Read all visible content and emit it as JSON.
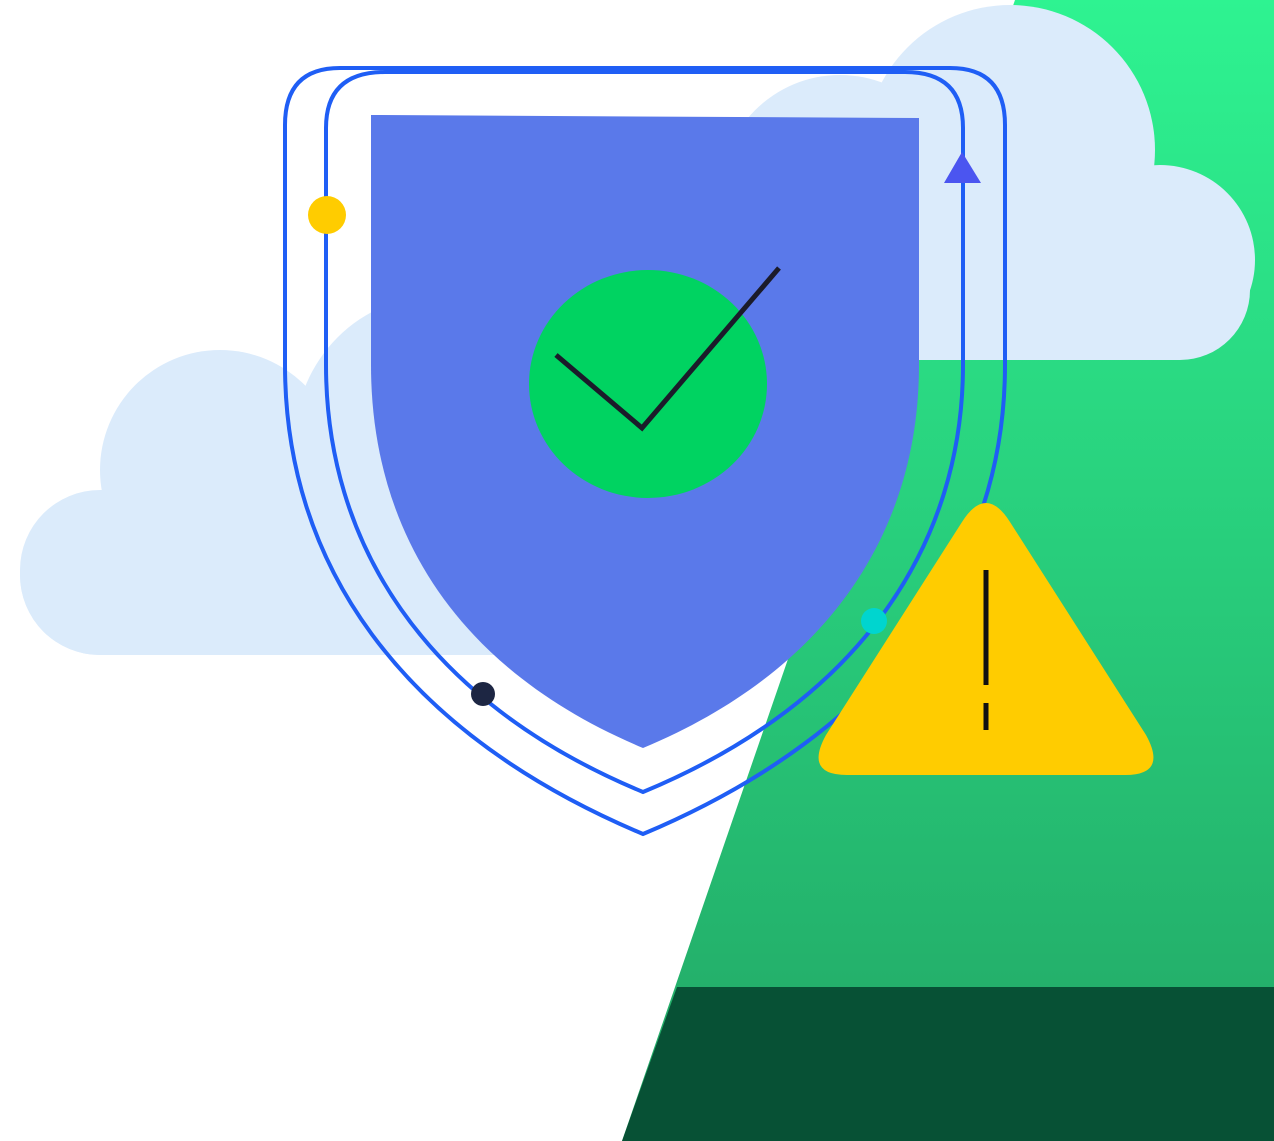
{
  "illustration": {
    "subject": "security-shield-with-warning",
    "icons": [
      "shield-icon",
      "check-icon",
      "warning-icon",
      "cloud-icon",
      "arrow-up-icon"
    ],
    "colors": {
      "background": "#FFFFFF",
      "cloud": "#DBEBFB",
      "shield_fill": "#5A79EA",
      "outline": "#1F5EF5",
      "check_circle": "#00D361",
      "check_mark": "#1B1B2A",
      "warning": "#FFCC00",
      "warning_mark": "#111111",
      "green_top": "#2EF391",
      "green_bottom": "#22A665",
      "dark_green": "#075135",
      "arrow": "#4B55F0",
      "dot_yellow": "#FFCC00",
      "dot_navy": "#1D2643",
      "dot_cyan": "#00D5CF"
    }
  }
}
